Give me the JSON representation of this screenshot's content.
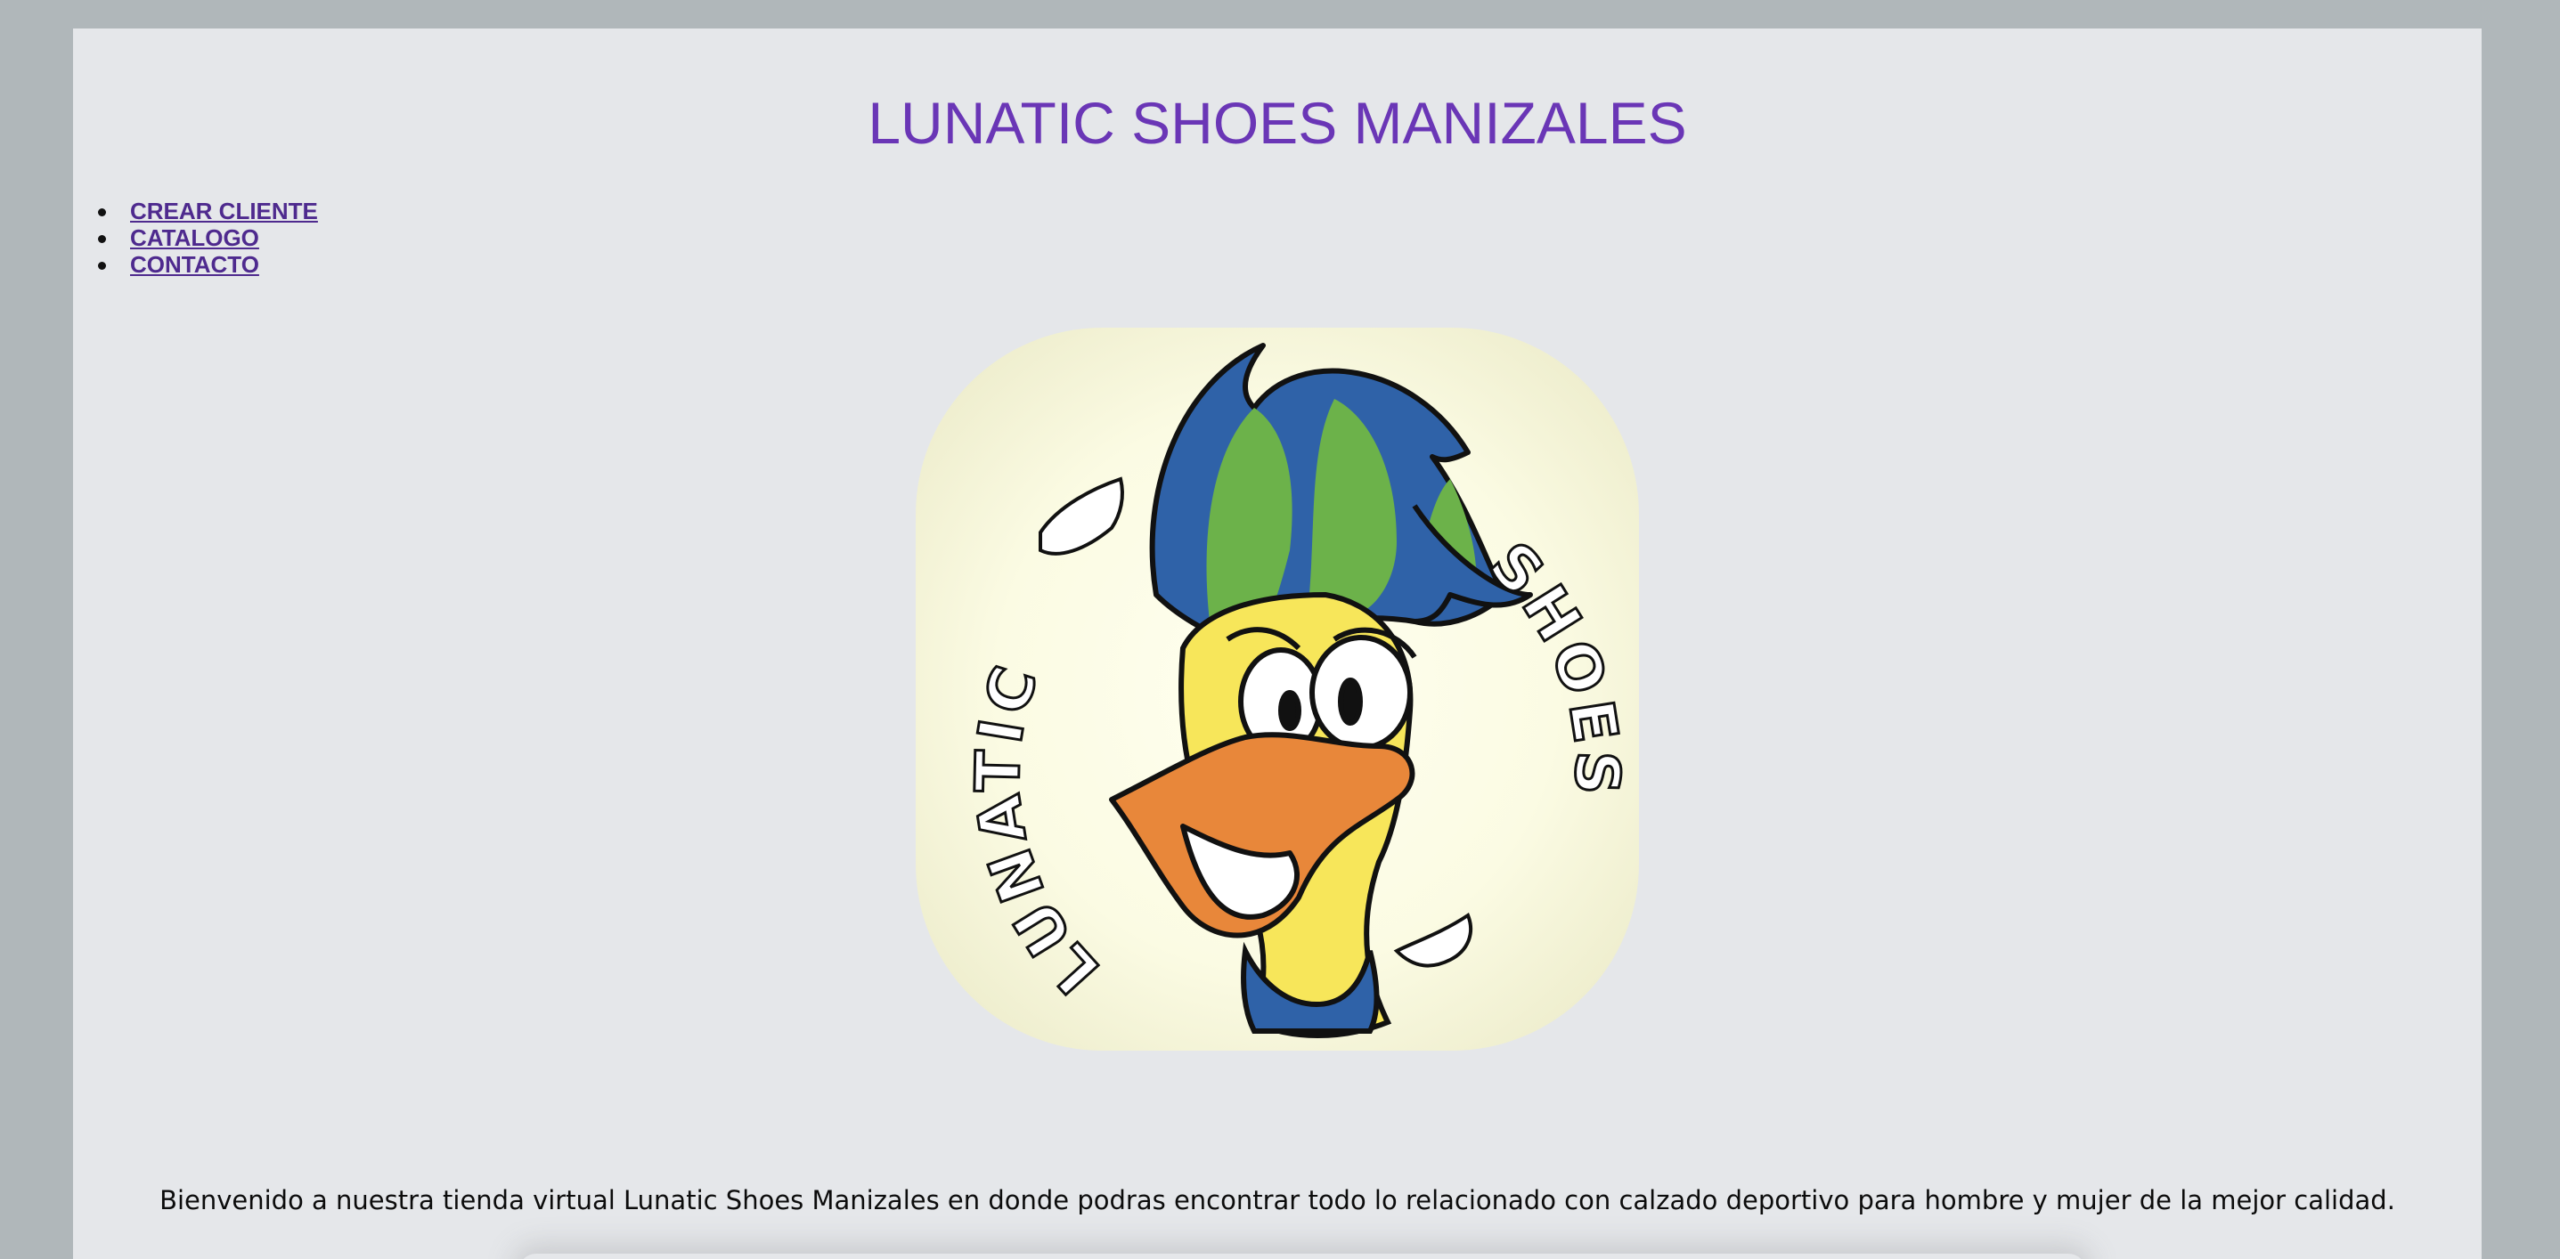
{
  "header": {
    "title": "LUNATIC SHOES MANIZALES"
  },
  "nav": {
    "items": [
      {
        "label": "CREAR CLIENTE"
      },
      {
        "label": "CATALOGO"
      },
      {
        "label": "CONTACTO"
      }
    ]
  },
  "logo": {
    "description_icon": "duck-mascot-logo",
    "brand_text": [
      "LUNATIC",
      "SHOES"
    ]
  },
  "main": {
    "welcome_text": "Bienvenido a nuestra tienda virtual Lunatic Shoes Manizales en donde podras encontrar todo lo relacionado con calzado deportivo para hombre y mujer de la mejor calidad."
  },
  "colors": {
    "page_bg": "#b0b7ba",
    "content_bg": "#e5e7ea",
    "title": "#6a36b6",
    "link": "#4e2a8e"
  }
}
